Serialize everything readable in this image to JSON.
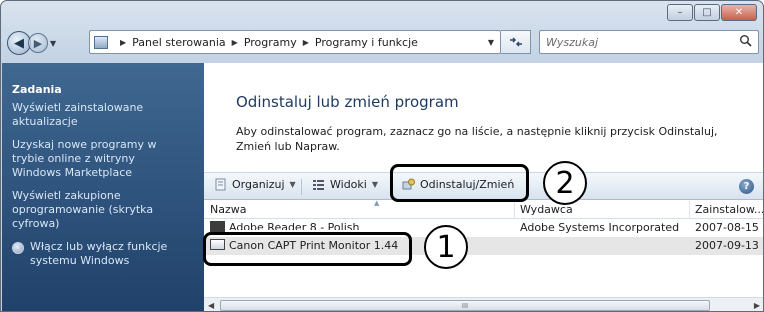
{
  "window": {
    "caption_buttons": {
      "minimize": "–",
      "maximize": "□",
      "close": "✕"
    }
  },
  "nav": {
    "back": "◀",
    "forward": "▶",
    "breadcrumbs": [
      "Panel sterowania",
      "Programy",
      "Programy i funkcje"
    ],
    "refresh": "⁴⁺",
    "search_placeholder": "Wyszukaj"
  },
  "sidebar": {
    "title": "Zadania",
    "items": [
      {
        "label": "Wyświetl zainstalowane aktualizacje"
      },
      {
        "label": "Uzyskaj nowe programy w trybie online z witryny Windows Marketplace"
      },
      {
        "label": "Wyświetl zakupione oprogramowanie (skrytka cyfrowa)"
      },
      {
        "label": "Włącz lub wyłącz funkcje systemu Windows",
        "icon": "shield-icon"
      }
    ]
  },
  "main": {
    "title": "Odinstaluj lub zmień program",
    "description": "Aby odinstalować program, zaznacz go na liście, a następnie kliknij przycisk Odinstaluj, Zmień lub Napraw."
  },
  "toolbar": {
    "organize": "Organizuj",
    "views": "Widoki",
    "uninstall_change": "Odinstaluj/Zmień",
    "help": "?"
  },
  "table": {
    "columns": [
      "Nazwa",
      "Wydawca",
      "Zainstalow..."
    ],
    "rows": [
      {
        "name": "Adobe Reader 8 - Polish",
        "publisher": "Adobe Systems Incorporated",
        "installed": "2007-08-15",
        "selected": false
      },
      {
        "name": "Canon CAPT Print Monitor 1.44",
        "publisher": "",
        "installed": "2007-09-13",
        "selected": true
      }
    ]
  },
  "scrollbar": {
    "left": "◀",
    "right": "▶",
    "grip": "III"
  },
  "callouts": {
    "one": "①",
    "two": "②",
    "one_text": "1",
    "two_text": "2"
  }
}
